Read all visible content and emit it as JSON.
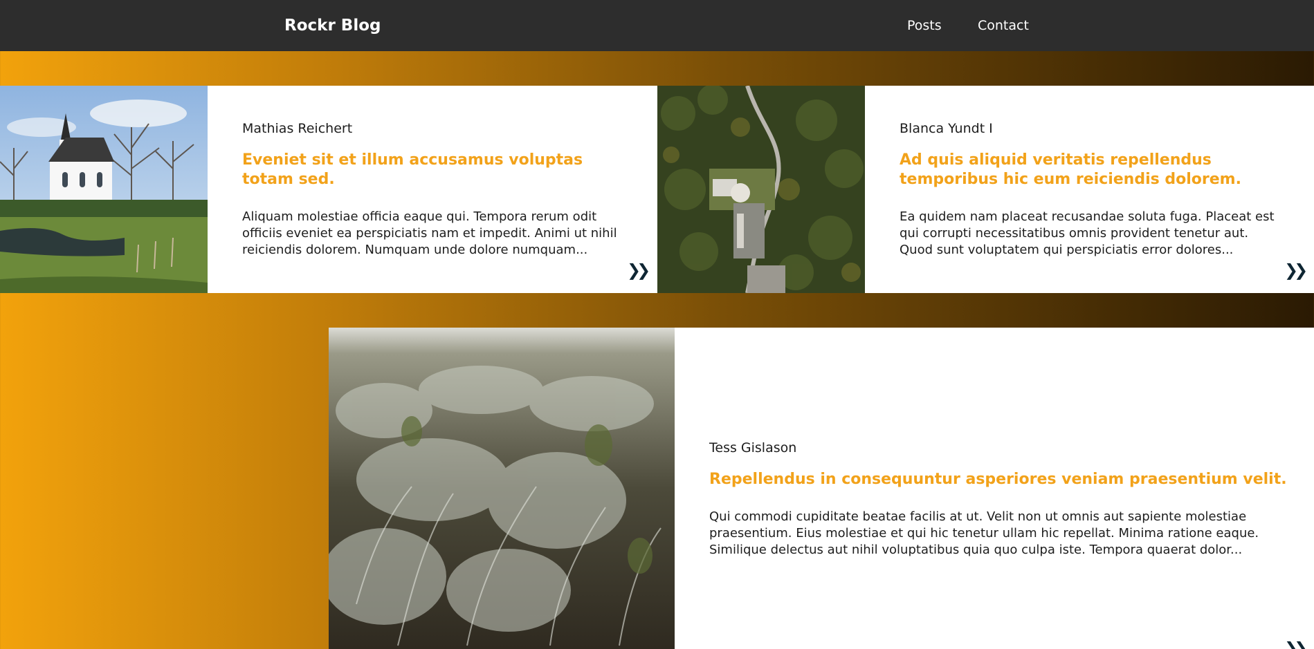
{
  "header": {
    "brand": "Rockr Blog",
    "nav": [
      {
        "label": "Posts"
      },
      {
        "label": "Contact"
      }
    ]
  },
  "colors": {
    "header_bg": "#2d2d2d",
    "accent": "#f2a21a",
    "gradient_start": "#f2a20c",
    "gradient_end": "#2a1a03"
  },
  "posts": [
    {
      "author": "Mathias Reichert",
      "title": "Eveniet sit et illum accusamus voluptas totam sed.",
      "excerpt": "Aliquam molestiae officia eaque qui. Tempora rerum odit officiis eveniet ea perspiciatis nam et impedit. Animi ut nihil reiciendis dolorem. Numquam unde dolore numquam...",
      "image": "church-photo",
      "arrow_icon": "double-chevron-right-icon"
    },
    {
      "author": "Blanca Yundt I",
      "title": "Ad quis aliquid veritatis repellendus temporibus hic eum reiciendis dolorem.",
      "excerpt": "Ea quidem nam placeat recusandae soluta fuga. Placeat est qui corrupti necessitatibus omnis provident tenetur aut. Quod sunt voluptatem qui perspiciatis error dolores...",
      "image": "aerial-valley-road-photo",
      "arrow_icon": "double-chevron-right-icon"
    },
    {
      "author": "Tess Gislason",
      "title": "Repellendus in consequuntur asperiores veniam praesentium velit.",
      "excerpt": "Qui commodi cupiditate beatae facilis at ut. Velit non ut omnis aut sapiente molestiae praesentium. Eius molestiae et qui hic tenetur ullam hic repellat. Minima ratione eaque. Similique delectus aut nihil voluptatibus quia quo culpa iste. Tempora quaerat dolor...",
      "image": "frosted-heather-photo",
      "arrow_icon": "double-chevron-right-icon"
    }
  ]
}
